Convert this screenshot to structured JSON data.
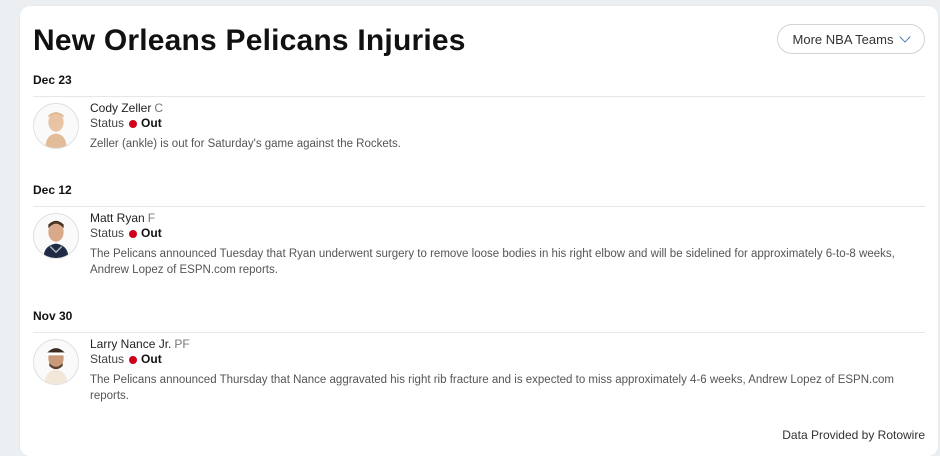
{
  "page": {
    "title": "New Orleans Pelicans Injuries",
    "more_button_label": "More NBA Teams"
  },
  "status_label": "Status",
  "groups": [
    {
      "date": "Dec 23",
      "player": {
        "name": "Cody Zeller",
        "position": "C",
        "status": "Out",
        "note": "Zeller (ankle) is out for Saturday's game against the Rockets."
      }
    },
    {
      "date": "Dec 12",
      "player": {
        "name": "Matt Ryan",
        "position": "F",
        "status": "Out",
        "note": "The Pelicans announced Tuesday that Ryan underwent surgery to remove loose bodies in his right elbow and will be sidelined for approximately 6-to-8 weeks, Andrew Lopez of ESPN.com reports."
      }
    },
    {
      "date": "Nov 30",
      "player": {
        "name": "Larry Nance Jr.",
        "position": "PF",
        "status": "Out",
        "note": "The Pelicans announced Thursday that Nance aggravated his right rib fracture and is expected to miss approximately 4-6 weeks, Andrew Lopez of ESPN.com reports."
      }
    }
  ],
  "footer": {
    "credit": "Data Provided by Rotowire"
  },
  "colors": {
    "status_out": "#d0021b",
    "chevron": "#4a7fb5"
  }
}
